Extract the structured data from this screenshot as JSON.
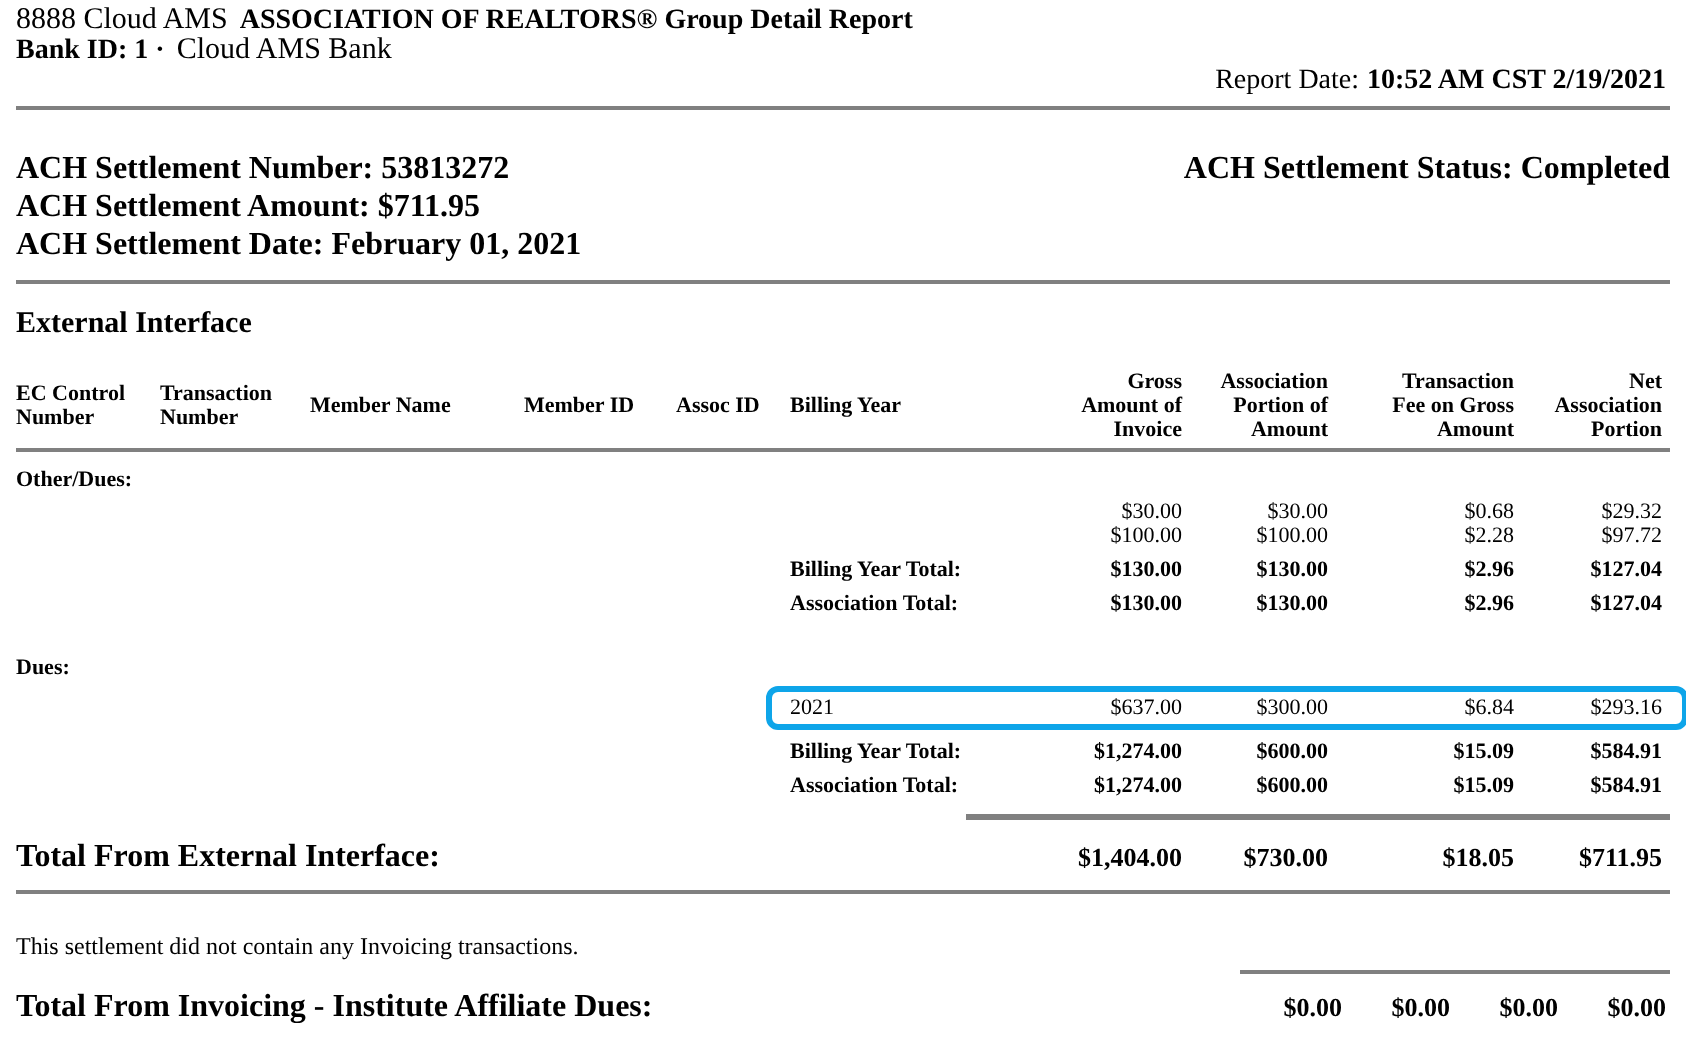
{
  "header": {
    "org": "8888 Cloud AMS",
    "title": "ASSOCIATION OF REALTORS® Group Detail Report",
    "bank_label": "Bank ID: 1 ·",
    "bank_name": "Cloud AMS Bank",
    "report_date_label": "Report Date:",
    "report_date": "10:52 AM CST 2/19/2021"
  },
  "settlement": {
    "lines": [
      "ACH Settlement Number: 53813272",
      "ACH Settlement Amount: $711.95",
      "ACH Settlement Date: February 01, 2021"
    ],
    "status": "ACH Settlement Status: Completed"
  },
  "section_title": "External Interface",
  "table": {
    "columns": [
      "EC Control Number",
      "Transaction Number",
      "Member Name",
      "Member ID",
      "Assoc ID",
      "Billing Year",
      "Gross Amount of Invoice",
      "Association Portion of Amount",
      "Transaction Fee on Gross Amount",
      "Net Association Portion"
    ],
    "groups": [
      {
        "label": "Other/Dues:",
        "rows": [
          {
            "kind": "data",
            "highlighted": false,
            "billing_year": "",
            "values": [
              "$30.00",
              "$30.00",
              "$0.68",
              "$29.32"
            ]
          },
          {
            "kind": "data",
            "highlighted": false,
            "billing_year": "",
            "values": [
              "$100.00",
              "$100.00",
              "$2.28",
              "$97.72"
            ]
          },
          {
            "kind": "total",
            "label": "Billing Year Total:",
            "values": [
              "$130.00",
              "$130.00",
              "$2.96",
              "$127.04"
            ]
          },
          {
            "kind": "total",
            "label": "Association Total:",
            "values": [
              "$130.00",
              "$130.00",
              "$2.96",
              "$127.04"
            ]
          }
        ]
      },
      {
        "label": "Dues:",
        "rows": [
          {
            "kind": "data",
            "highlighted": true,
            "billing_year": "2021",
            "values": [
              "$637.00",
              "$300.00",
              "$6.84",
              "$293.16"
            ]
          },
          {
            "kind": "total",
            "label": "Billing Year Total:",
            "values": [
              "$1,274.00",
              "$600.00",
              "$15.09",
              "$584.91"
            ]
          },
          {
            "kind": "total",
            "label": "Association Total:",
            "values": [
              "$1,274.00",
              "$600.00",
              "$15.09",
              "$584.91"
            ]
          }
        ]
      }
    ]
  },
  "external_total": {
    "label": "Total From External Interface:",
    "values": [
      "$1,404.00",
      "$730.00",
      "$18.05",
      "$711.95"
    ]
  },
  "invoicing_note": "This settlement did not contain any Invoicing transactions.",
  "invoicing_total": {
    "label": "Total From Invoicing - Institute Affiliate Dues:",
    "values": [
      "$0.00",
      "$0.00",
      "$0.00",
      "$0.00"
    ]
  }
}
